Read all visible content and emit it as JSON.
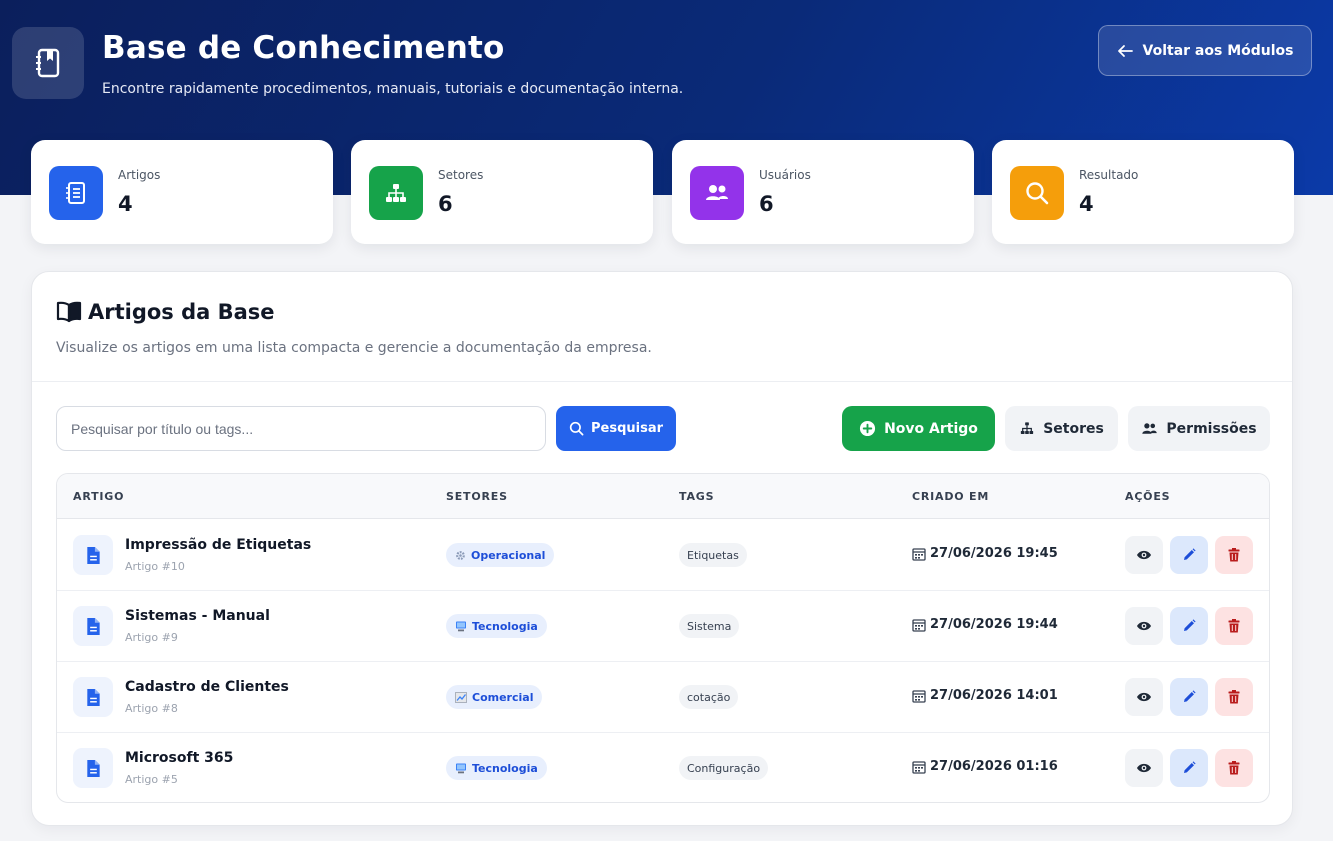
{
  "header": {
    "title": "Base de Conhecimento",
    "subtitle": "Encontre rapidamente procedimentos, manuais, tutoriais e documentação interna.",
    "back_label": "Voltar aos Módulos"
  },
  "stats": [
    {
      "label": "Artigos",
      "value": "4",
      "icon": "book-icon",
      "color": "#2563eb"
    },
    {
      "label": "Setores",
      "value": "6",
      "icon": "sitemap-icon",
      "color": "#16a34a"
    },
    {
      "label": "Usuários",
      "value": "6",
      "icon": "users-icon",
      "color": "#9333ea"
    },
    {
      "label": "Resultado",
      "value": "4",
      "icon": "search-icon",
      "color": "#f59e0b"
    }
  ],
  "panel": {
    "title": "Artigos da Base",
    "subtitle": "Visualize os artigos em uma lista compacta e gerencie a documentação da empresa."
  },
  "toolbar": {
    "search_placeholder": "Pesquisar por título ou tags...",
    "search_value": "",
    "search_label": "Pesquisar",
    "new_label": "Novo Artigo",
    "sectors_label": "Setores",
    "permissions_label": "Permissões"
  },
  "table": {
    "columns": [
      "ARTIGO",
      "SETORES",
      "TAGS",
      "CRIADO EM",
      "AÇÕES"
    ],
    "rows": [
      {
        "title": "Impressão de Etiquetas",
        "id": "Artigo #10",
        "sector": "Operacional",
        "sector_icon": "gear-icon",
        "tag": "Etiquetas",
        "created": "27/06/2026 19:45"
      },
      {
        "title": "Sistemas - Manual",
        "id": "Artigo #9",
        "sector": "Tecnologia",
        "sector_icon": "computer-icon",
        "tag": "Sistema",
        "created": "27/06/2026 19:44"
      },
      {
        "title": "Cadastro de Clientes",
        "id": "Artigo #8",
        "sector": "Comercial",
        "sector_icon": "chart-icon",
        "tag": "cotação",
        "created": "27/06/2026 14:01"
      },
      {
        "title": "Microsoft 365",
        "id": "Artigo #5",
        "sector": "Tecnologia",
        "sector_icon": "computer-icon",
        "tag": "Configuração",
        "created": "27/06/2026 01:16"
      }
    ]
  }
}
